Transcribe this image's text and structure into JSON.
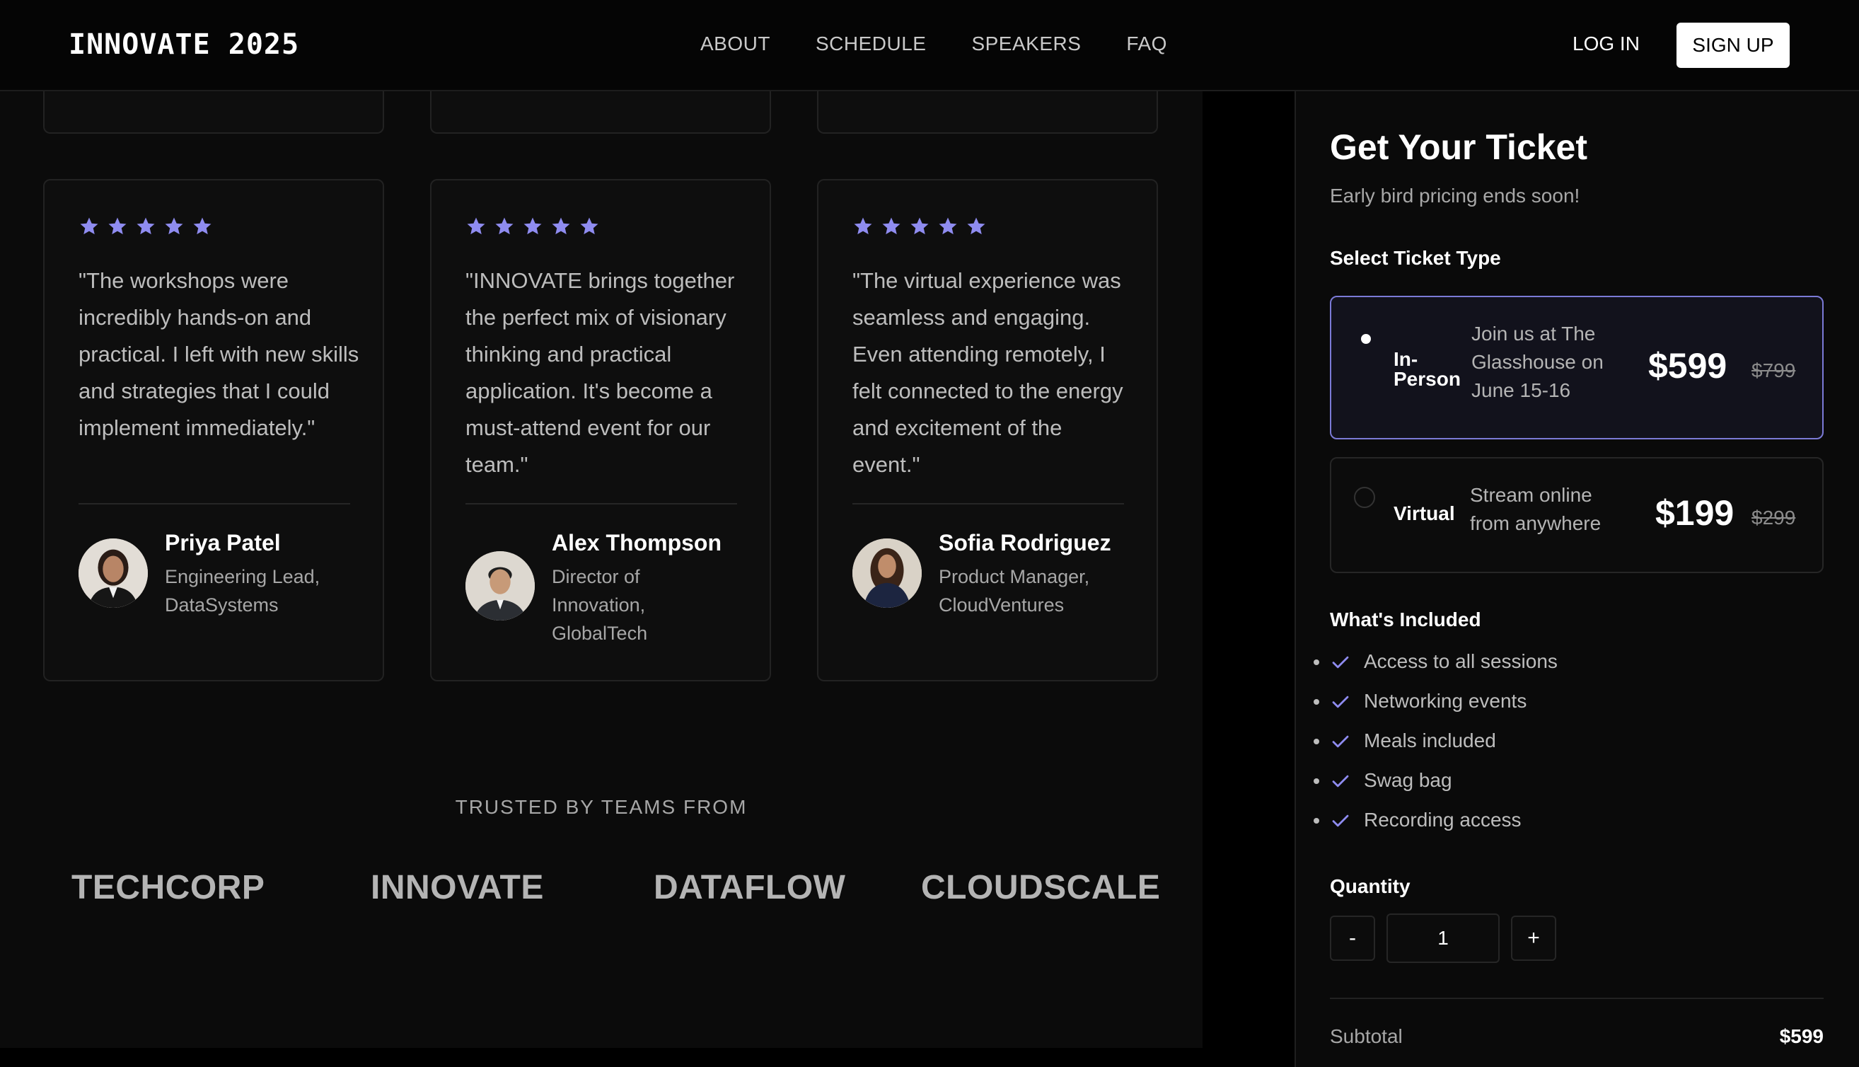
{
  "nav": {
    "brand": "INNOVATE 2025",
    "links": [
      "ABOUT",
      "SCHEDULE",
      "SPEAKERS",
      "FAQ"
    ],
    "login": "LOG IN",
    "signup": "SIGN UP"
  },
  "testimonials": [
    {
      "rating": 5,
      "quote": "\"The workshops were incredibly hands-on and practical. I left with new skills and strategies that I could implement immediately.\"",
      "name": "Priya Patel",
      "role": "Engineering Lead, DataSystems"
    },
    {
      "rating": 5,
      "quote": "\"INNOVATE brings together the perfect mix of visionary thinking and practical application. It's become a must-attend event for our team.\"",
      "name": "Alex Thompson",
      "role": "Director of Innovation, GlobalTech"
    },
    {
      "rating": 5,
      "quote": "\"The virtual experience was seamless and engaging. Even attending remotely, I felt connected to the energy and excitement of the event.\"",
      "name": "Sofia Rodriguez",
      "role": "Product Manager, CloudVentures"
    }
  ],
  "trusted": {
    "label": "TRUSTED BY TEAMS FROM",
    "logos": [
      "TECHCORP",
      "INNOVATE",
      "DATAFLOW",
      "CLOUDSCALE"
    ]
  },
  "ticket_panel": {
    "title": "Get Your Ticket",
    "subtitle": "Early bird pricing ends soon!",
    "select_label": "Select Ticket Type",
    "options": [
      {
        "name": "In-Person",
        "description": "Join us at The Glasshouse on June 15-16",
        "price": "$599",
        "old_price": "$799",
        "selected": true
      },
      {
        "name": "Virtual",
        "description": "Stream online from anywhere",
        "price": "$199",
        "old_price": "$299",
        "selected": false
      }
    ],
    "included_label": "What's Included",
    "included": [
      "Access to all sessions",
      "Networking events",
      "Meals included",
      "Swag bag",
      "Recording access"
    ],
    "quantity_label": "Quantity",
    "quantity": "1",
    "minus": "-",
    "plus": "+",
    "subtotal_label": "Subtotal",
    "subtotal_value": "$599"
  },
  "colors": {
    "accent": "#8f8cf0",
    "selected_border": "#7b7ad6"
  }
}
